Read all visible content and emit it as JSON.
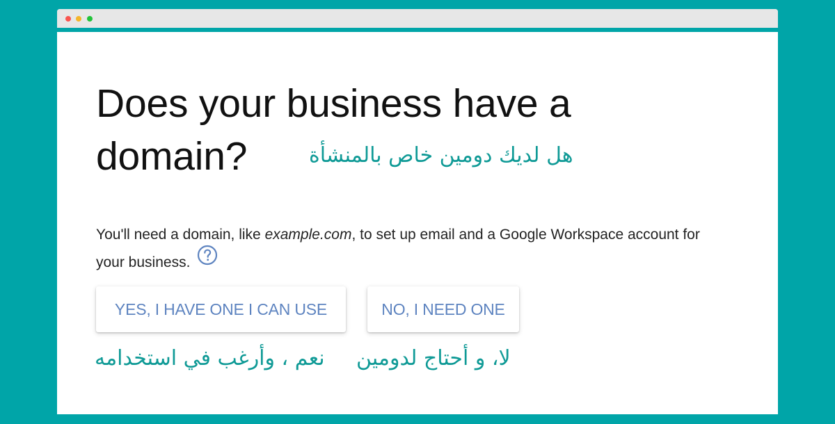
{
  "window": {
    "controls": [
      "close",
      "minimize",
      "zoom"
    ]
  },
  "main": {
    "heading": "Does your business have a domain?",
    "heading_annotation_ar": "هل لديك دومين خاص بالمنشأة",
    "description_before": "You'll need a domain, like ",
    "description_example": "example.com",
    "description_after": ", to set up email and a Google Workspace account for your business.",
    "help_icon": "help-circle-icon"
  },
  "actions": {
    "yes_label": "YES, I HAVE ONE I CAN USE",
    "no_label": "NO, I NEED ONE",
    "yes_annotation_ar": "نعم ، وأرغب في استخدامه",
    "no_annotation_ar": "لا، و أحتاج لدومين"
  },
  "colors": {
    "background": "#00a5a8",
    "button_text": "#5e84c0",
    "annotation": "#0f9a96",
    "help_icon": "#5e84c0"
  }
}
